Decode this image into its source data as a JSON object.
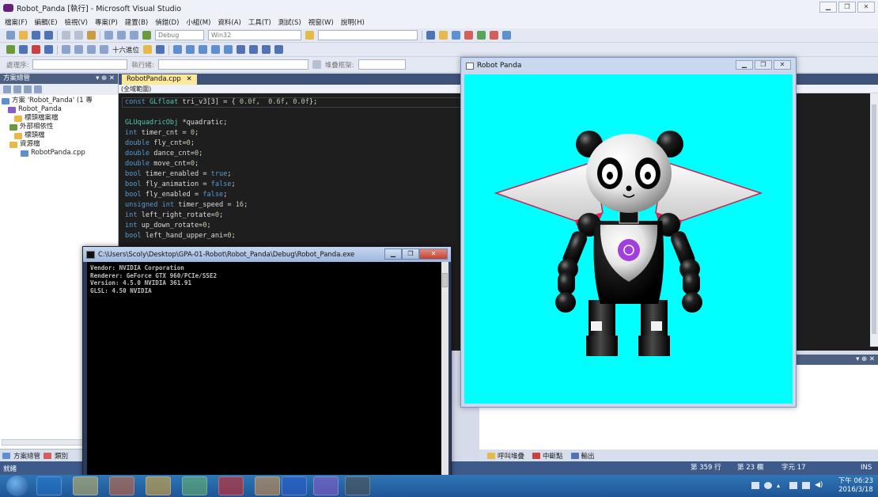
{
  "vs": {
    "title": "Robot_Panda [執行] - Microsoft Visual Studio",
    "menu": [
      "檔案(F)",
      "編輯(E)",
      "檢視(V)",
      "專案(P)",
      "建置(B)",
      "偵錯(D)",
      "小組(M)",
      "資料(A)",
      "工具(T)",
      "測試(S)",
      "視窗(W)",
      "說明(H)"
    ],
    "toolbar": {
      "config": "Debug",
      "platform": "Win32",
      "hex_label": "十六進位",
      "process_label": "處理序:",
      "thread_label": "執行緒:",
      "stack_label": "堆疊框架:"
    },
    "solution_explorer": {
      "title": "方案總管",
      "pin": "▾ ⊕ ✕",
      "items": [
        "方案 'Robot_Panda' (1 專",
        "Robot_Panda",
        "標頭檔案檔",
        "外部相依性",
        "標頭檔",
        "資源檔",
        "RobotPanda.cpp"
      ],
      "bottom_tabs": [
        "方案總管",
        "類別"
      ]
    },
    "editor": {
      "tab": "RobotPanda.cpp",
      "tab_close": "✕",
      "scope": "(全域範圍)",
      "code": [
        [
          [
            "kw",
            "const "
          ],
          [
            "ty",
            "GLfloat "
          ],
          [
            "id",
            "tri_v3"
          ],
          [
            "op",
            "[3] = { "
          ],
          [
            "nu",
            "0.0f"
          ],
          [
            "op",
            ",  "
          ],
          [
            "nu",
            "0.6f"
          ],
          [
            "op",
            ", "
          ],
          [
            "nu",
            "0.0f"
          ],
          [
            "op",
            "};"
          ]
        ],
        [],
        [
          [
            "ty",
            "GLUquadricObj "
          ],
          [
            "op",
            "*"
          ],
          [
            "id",
            "quadratic"
          ],
          [
            "op",
            ";"
          ]
        ],
        [
          [
            "kw",
            "int "
          ],
          [
            "id",
            "timer_cnt "
          ],
          [
            "op",
            "= "
          ],
          [
            "nu",
            "0"
          ],
          [
            "op",
            ";"
          ]
        ],
        [
          [
            "kw",
            "double "
          ],
          [
            "id",
            "fly_cnt"
          ],
          [
            "op",
            "="
          ],
          [
            "nu",
            "0"
          ],
          [
            "op",
            ";"
          ]
        ],
        [
          [
            "kw",
            "double "
          ],
          [
            "id",
            "dance_cnt"
          ],
          [
            "op",
            "="
          ],
          [
            "nu",
            "0"
          ],
          [
            "op",
            ";"
          ]
        ],
        [
          [
            "kw",
            "double "
          ],
          [
            "id",
            "move_cnt"
          ],
          [
            "op",
            "="
          ],
          [
            "nu",
            "0"
          ],
          [
            "op",
            ";"
          ]
        ],
        [
          [
            "kw",
            "bool "
          ],
          [
            "id",
            "timer_enabled "
          ],
          [
            "op",
            "= "
          ],
          [
            "kw",
            "true"
          ],
          [
            "op",
            ";"
          ]
        ],
        [
          [
            "kw",
            "bool "
          ],
          [
            "id",
            "fly_animation "
          ],
          [
            "op",
            "= "
          ],
          [
            "kw",
            "false"
          ],
          [
            "op",
            ";"
          ]
        ],
        [
          [
            "kw",
            "bool "
          ],
          [
            "id",
            "fly_enabled "
          ],
          [
            "op",
            "= "
          ],
          [
            "kw",
            "false"
          ],
          [
            "op",
            ";"
          ]
        ],
        [
          [
            "kw",
            "unsigned int "
          ],
          [
            "id",
            "timer_speed "
          ],
          [
            "op",
            "= "
          ],
          [
            "nu",
            "16"
          ],
          [
            "op",
            ";"
          ]
        ],
        [
          [
            "kw",
            "int "
          ],
          [
            "id",
            "left_right_rotate"
          ],
          [
            "op",
            "="
          ],
          [
            "nu",
            "0"
          ],
          [
            "op",
            ";"
          ]
        ],
        [
          [
            "kw",
            "int "
          ],
          [
            "id",
            "up_down_rotate"
          ],
          [
            "op",
            "="
          ],
          [
            "nu",
            "0"
          ],
          [
            "op",
            ";"
          ]
        ],
        [
          [
            "kw",
            "bool "
          ],
          [
            "id",
            "left_hand_upper_ani"
          ],
          [
            "op",
            "="
          ],
          [
            "nu",
            "0"
          ],
          [
            "op",
            ";"
          ]
        ]
      ]
    },
    "output_tabs": [
      "呼叫堆疊",
      "中斷點",
      "輸出"
    ],
    "status": {
      "ready": "就緒",
      "line": "第 359 行",
      "col": "第 23 欄",
      "char": "字元 17",
      "mode": "INS"
    }
  },
  "console": {
    "title": "C:\\Users\\Scoly\\Desktop\\GPA-01-Robot\\Robot_Panda\\Debug\\Robot_Panda.exe",
    "lines": [
      "Vendor: NVIDIA Corporation",
      "Renderer: GeForce GTX 960/PCIe/SSE2",
      "Version: 4.5.0 NVIDIA 361.91",
      "GLSL: 4.50 NVIDIA"
    ]
  },
  "panda_window": {
    "title": "Robot Panda",
    "canvas_color": "#00ffff",
    "emblem_color": "#a23ee0"
  },
  "taskbar": {
    "time": "下午 06:23",
    "date": "2016/3/18"
  }
}
